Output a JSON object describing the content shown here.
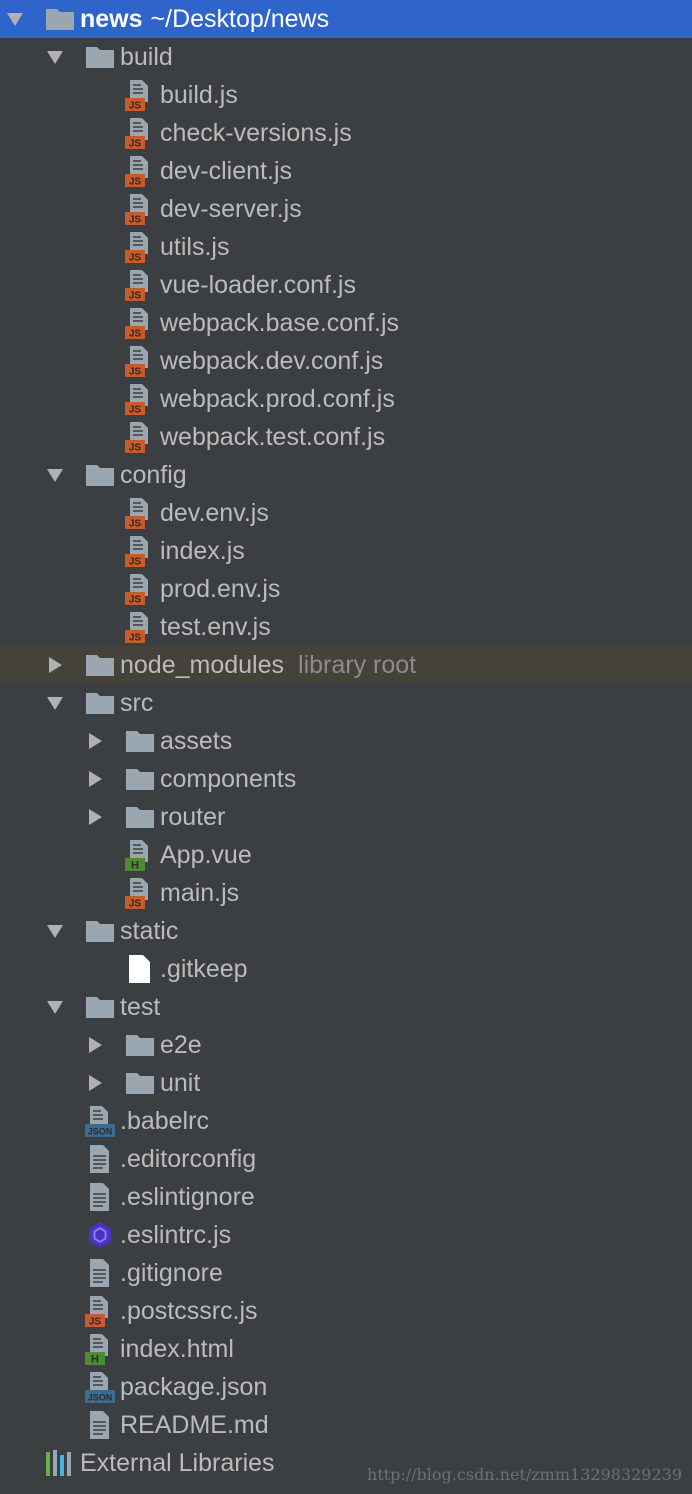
{
  "colors": {
    "background": "#3c3f41",
    "selected": "#2f65ca",
    "highlight": "#45423b",
    "folder": "#9aa7b0",
    "js_badge": "#c75b2c",
    "html_badge": "#4c8a33",
    "json_badge": "#3a6d8f",
    "eslint": "#4b32c3"
  },
  "tree": [
    {
      "level": 0,
      "expanded": true,
      "icon": "folder-icon",
      "name": "news",
      "hint": "~/Desktop/news",
      "selected": true
    },
    {
      "level": 1,
      "expanded": true,
      "icon": "folder-icon",
      "name": "build"
    },
    {
      "level": 2,
      "icon": "js-file-icon",
      "name": "build.js"
    },
    {
      "level": 2,
      "icon": "js-file-icon",
      "name": "check-versions.js"
    },
    {
      "level": 2,
      "icon": "js-file-icon",
      "name": "dev-client.js"
    },
    {
      "level": 2,
      "icon": "js-file-icon",
      "name": "dev-server.js"
    },
    {
      "level": 2,
      "icon": "js-file-icon",
      "name": "utils.js"
    },
    {
      "level": 2,
      "icon": "js-file-icon",
      "name": "vue-loader.conf.js"
    },
    {
      "level": 2,
      "icon": "js-file-icon",
      "name": "webpack.base.conf.js"
    },
    {
      "level": 2,
      "icon": "js-file-icon",
      "name": "webpack.dev.conf.js"
    },
    {
      "level": 2,
      "icon": "js-file-icon",
      "name": "webpack.prod.conf.js"
    },
    {
      "level": 2,
      "icon": "js-file-icon",
      "name": "webpack.test.conf.js"
    },
    {
      "level": 1,
      "expanded": true,
      "icon": "folder-icon",
      "name": "config"
    },
    {
      "level": 2,
      "icon": "js-file-icon",
      "name": "dev.env.js"
    },
    {
      "level": 2,
      "icon": "js-file-icon",
      "name": "index.js"
    },
    {
      "level": 2,
      "icon": "js-file-icon",
      "name": "prod.env.js"
    },
    {
      "level": 2,
      "icon": "js-file-icon",
      "name": "test.env.js"
    },
    {
      "level": 1,
      "expanded": false,
      "icon": "folder-icon",
      "name": "node_modules",
      "hint": "library root",
      "highlight": true
    },
    {
      "level": 1,
      "expanded": true,
      "icon": "folder-icon",
      "name": "src"
    },
    {
      "level": 2,
      "expanded": false,
      "icon": "folder-icon",
      "name": "assets"
    },
    {
      "level": 2,
      "expanded": false,
      "icon": "folder-icon",
      "name": "components"
    },
    {
      "level": 2,
      "expanded": false,
      "icon": "folder-icon",
      "name": "router"
    },
    {
      "level": 2,
      "icon": "html-file-icon",
      "name": "App.vue"
    },
    {
      "level": 2,
      "icon": "js-file-icon",
      "name": "main.js"
    },
    {
      "level": 1,
      "expanded": true,
      "icon": "folder-icon",
      "name": "static"
    },
    {
      "level": 2,
      "icon": "blank-file-icon",
      "name": ".gitkeep"
    },
    {
      "level": 1,
      "expanded": true,
      "icon": "folder-icon",
      "name": "test"
    },
    {
      "level": 2,
      "expanded": false,
      "icon": "folder-icon",
      "name": "e2e"
    },
    {
      "level": 2,
      "expanded": false,
      "icon": "folder-icon",
      "name": "unit"
    },
    {
      "level": 1,
      "icon": "json-file-icon",
      "name": ".babelrc"
    },
    {
      "level": 1,
      "icon": "text-file-icon",
      "name": ".editorconfig"
    },
    {
      "level": 1,
      "icon": "text-file-icon",
      "name": ".eslintignore"
    },
    {
      "level": 1,
      "icon": "eslint-icon",
      "name": ".eslintrc.js"
    },
    {
      "level": 1,
      "icon": "text-file-icon",
      "name": ".gitignore"
    },
    {
      "level": 1,
      "icon": "js-file-icon",
      "name": ".postcssrc.js"
    },
    {
      "level": 1,
      "icon": "html-file-icon",
      "name": "index.html"
    },
    {
      "level": 1,
      "icon": "json-file-icon",
      "name": "package.json"
    },
    {
      "level": 1,
      "icon": "text-file-icon",
      "name": "README.md"
    },
    {
      "level": 0,
      "icon": "libraries-icon",
      "name": "External Libraries"
    }
  ],
  "badges": {
    "js": "JS",
    "html": "H",
    "json": "JSON"
  },
  "watermark": "http://blog.csdn.net/zmm13298329239"
}
